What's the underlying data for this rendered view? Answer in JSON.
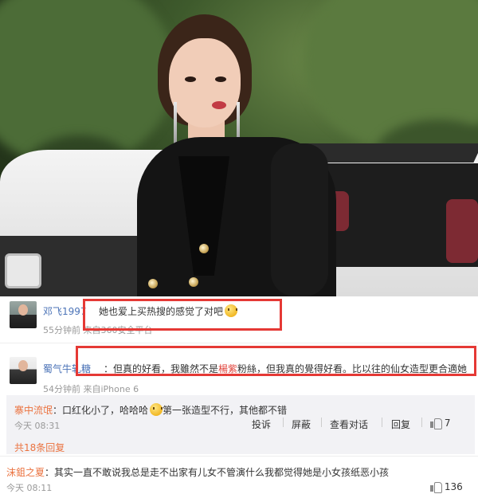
{
  "photo": {
    "alt": "drama still"
  },
  "comments": [
    {
      "username": "邓飞1997",
      "text": "她也爱上买热搜的感觉了对吧",
      "emoji": "smile-emoji",
      "meta": "55分钟前 来自360安全平台"
    },
    {
      "username": "蜀气牛轧糖",
      "text_prefix": "：但真的好看，我雖然不是",
      "highlight": "楊紫",
      "text_suffix": "粉絲，但我真的覺得好看。比以往的仙女造型更合適她",
      "meta": "54分钟前 来自iPhone 6"
    }
  ],
  "reply": {
    "username": "寨中流氓",
    "text": "：口红化小了，哈哈哈",
    "text2": "第一张造型不行，其他都不错",
    "time": "今天 08:31",
    "actions": {
      "report": "投诉",
      "block": "屏蔽",
      "view_conversation": "查看对话",
      "reply": "回复",
      "like_count": "7"
    },
    "more_replies": "共18条回复"
  },
  "bottom_comment": {
    "username": "沫鉏之夏",
    "text": "：其实一直不敢说我总是走不出家有儿女不管演什么我都觉得她是小女孩纸恶小孩",
    "time": "今天 08:11",
    "like_count": "136"
  },
  "colors": {
    "username_blue": "#4b73b7",
    "reply_orange": "#eb7340",
    "highlight_red": "#e1443c",
    "annotation_red": "#e53935"
  }
}
